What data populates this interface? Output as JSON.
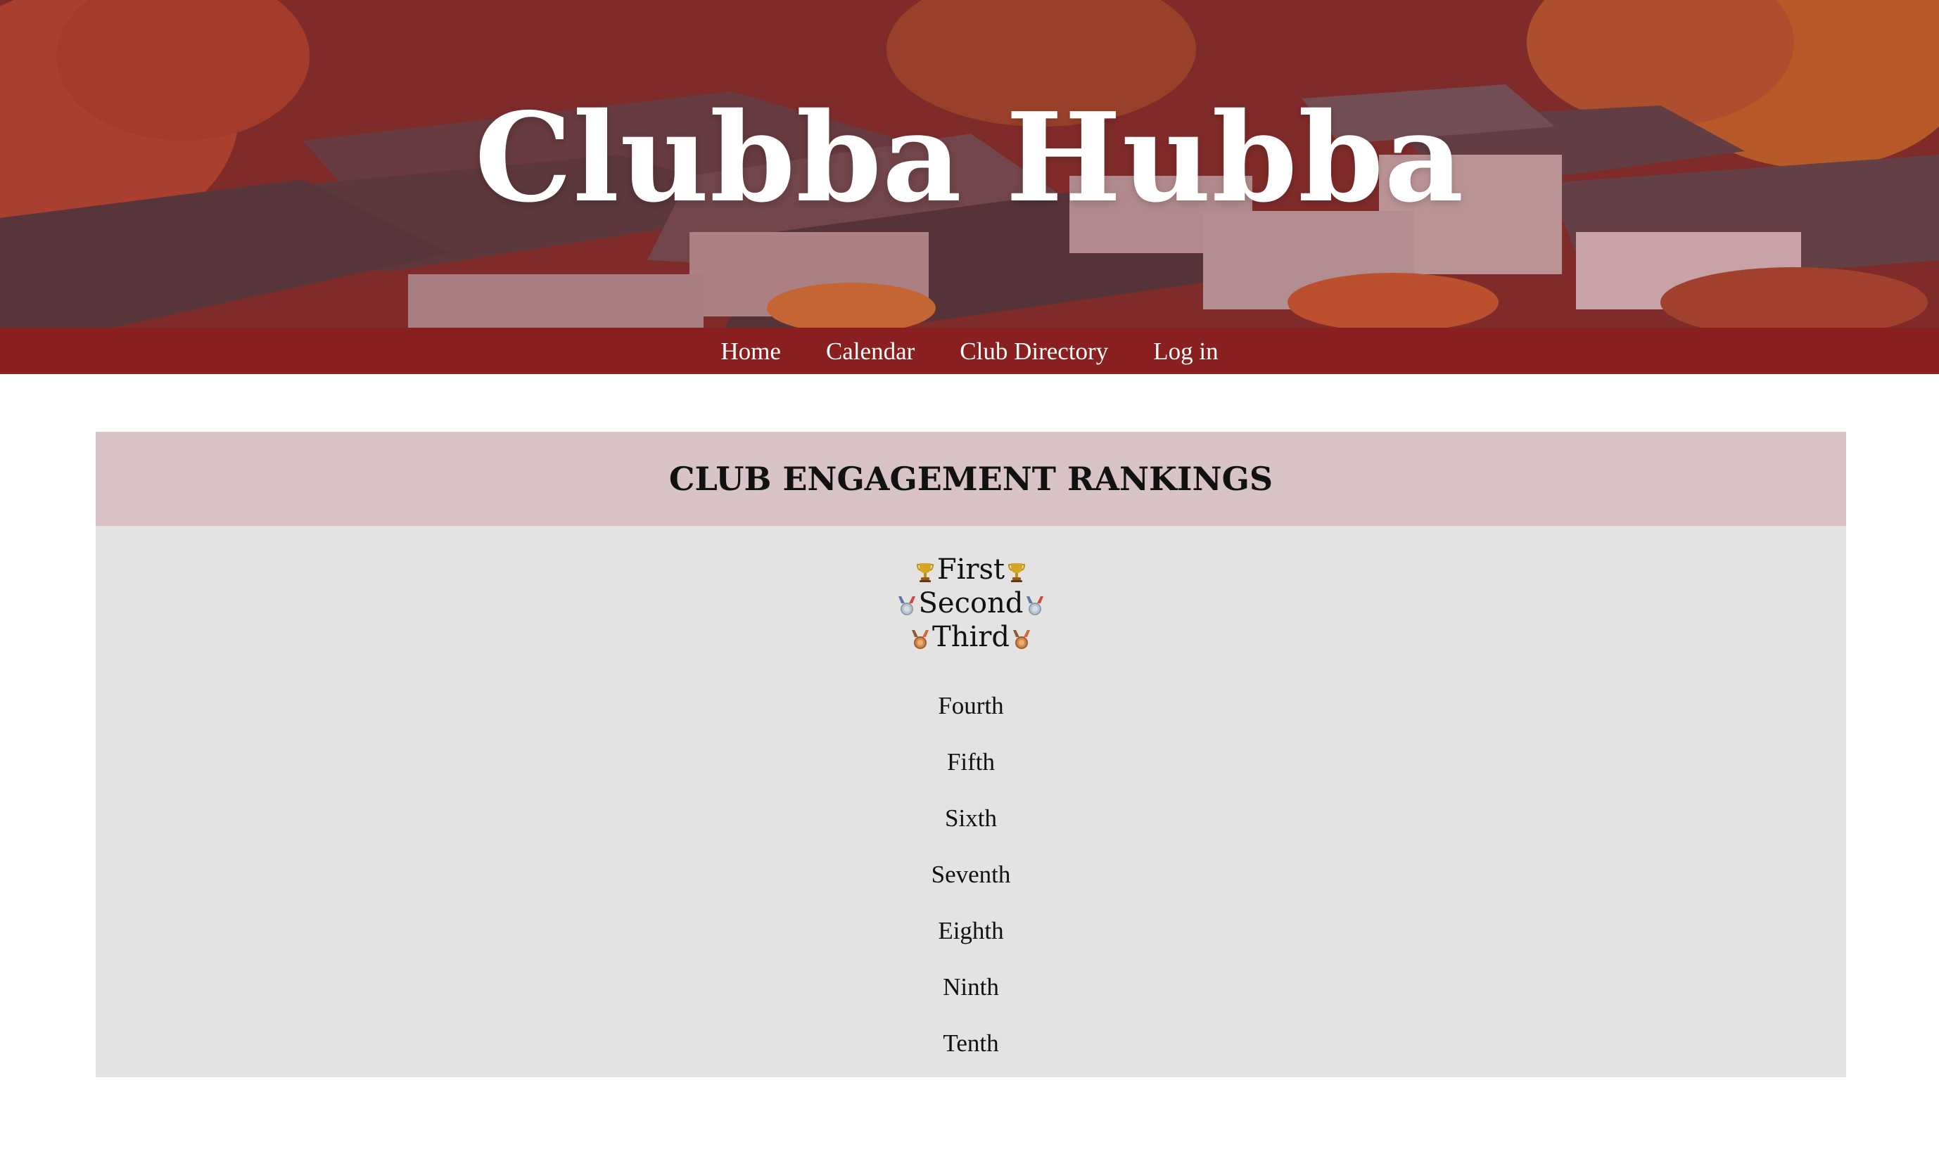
{
  "site": {
    "title": "Clubba Hubba"
  },
  "nav": {
    "items": [
      {
        "label": "Home"
      },
      {
        "label": "Calendar"
      },
      {
        "label": "Club Directory"
      },
      {
        "label": "Log in"
      }
    ]
  },
  "rankings": {
    "title": "CLUB ENGAGEMENT RANKINGS",
    "podium": [
      {
        "label": "First",
        "icon": "trophy-icon"
      },
      {
        "label": "Second",
        "icon": "silver-medal-icon"
      },
      {
        "label": "Third",
        "icon": "bronze-medal-icon"
      }
    ],
    "others": [
      {
        "label": "Fourth"
      },
      {
        "label": "Fifth"
      },
      {
        "label": "Sixth"
      },
      {
        "label": "Seventh"
      },
      {
        "label": "Eighth"
      },
      {
        "label": "Ninth"
      },
      {
        "label": "Tenth"
      }
    ]
  },
  "colors": {
    "nav_background": "#8a1f1f",
    "card_header": "#d8c4c6",
    "card_body": "#e4e3e2",
    "text": "#111111",
    "hero_text": "#ffffff"
  }
}
